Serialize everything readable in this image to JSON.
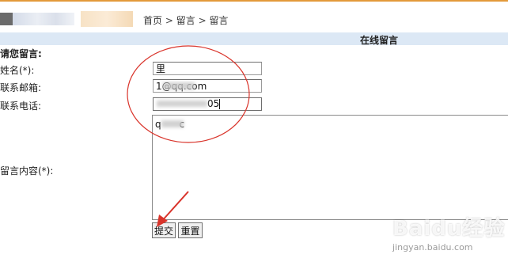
{
  "breadcrumb": {
    "home": "首页",
    "sep1": " >",
    "level1": "留言",
    "sep2": " >",
    "level2": "留言"
  },
  "section": {
    "title": "在线留言"
  },
  "form": {
    "heading": "请您留言:",
    "name_label": "姓名(*):",
    "name_value": "里",
    "email_label": "联系邮箱:",
    "email_value": "1⁠⁠⁠⁠⁠⁠⁠⁠⁠⁠⁠⁠⁠⁠@qq.com",
    "phone_label": "联系电话:",
    "phone_value": "05",
    "content_label": "留言内容(*):",
    "content_value": "q      c",
    "submit_label": "提交",
    "reset_label": "重置"
  },
  "watermark": {
    "brand": "Baidu经验",
    "url": "jingyan.baidu.com"
  },
  "colors": {
    "accent_top": "#e39a3a",
    "section_bar": "#dce8f5",
    "annotation": "#d9342b"
  }
}
